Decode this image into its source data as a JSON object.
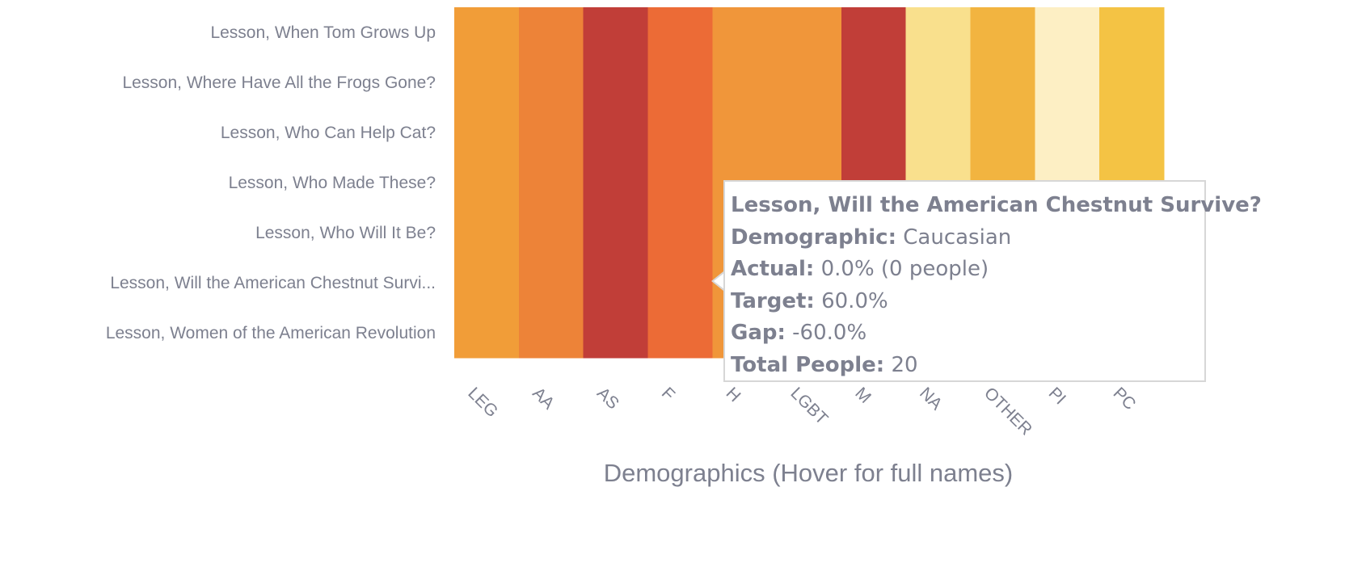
{
  "chart_data": {
    "type": "heatmap",
    "xlabel": "Demographics (Hover for full names)",
    "rows": [
      "Lesson, When Tom Grows Up",
      "Lesson, Where Have All the Frogs Gone?",
      "Lesson, Who Can Help Cat?",
      "Lesson, Who Made These?",
      "Lesson, Who Will It Be?",
      "Lesson, Will the American Chestnut Survi...",
      "Lesson, Women of the American Revolution"
    ],
    "columns": [
      "LEG",
      "AA",
      "AS",
      "F",
      "H",
      "LGBT",
      "M",
      "NA",
      "OTHER",
      "PI",
      "PC"
    ],
    "column_colors": [
      "#f19d38",
      "#ed8338",
      "#c13e38",
      "#ec6b36",
      "#f0963a",
      "#f0963a",
      "#c13e38",
      "#f9e08d",
      "#f2b440",
      "#fdefc4",
      "#f4c344"
    ],
    "tooltip": {
      "title": "Lesson, Will the American Chestnut Survive?",
      "demographic_label": "Demographic:",
      "demographic_value": "Caucasian",
      "actual_label": "Actual:",
      "actual_value": "0.0% (0 people)",
      "target_label": "Target:",
      "target_value": "60.0%",
      "gap_label": "Gap:",
      "gap_value": "-60.0%",
      "total_label": "Total People:",
      "total_value": "20"
    }
  }
}
